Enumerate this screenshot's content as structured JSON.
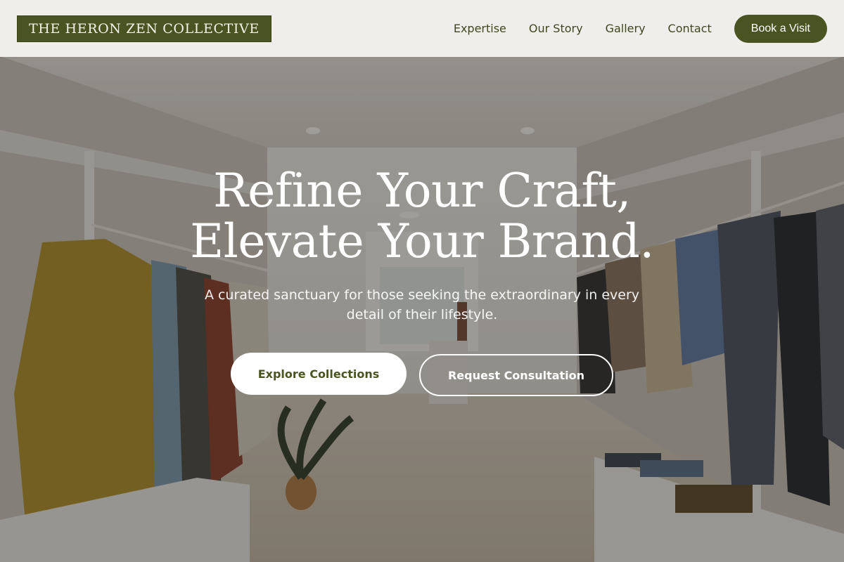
{
  "colors": {
    "brand": "#4a5422",
    "header_bg": "#f4f2ee",
    "text_light": "#ffffff"
  },
  "header": {
    "logo_text": "THE HERON ZEN COLLECTIVE",
    "nav": [
      {
        "label": "Expertise"
      },
      {
        "label": "Our Story"
      },
      {
        "label": "Gallery"
      },
      {
        "label": "Contact"
      }
    ],
    "cta_label": "Book a Visit"
  },
  "hero": {
    "headline_line1": "Refine Your Craft,",
    "headline_line2": "Elevate Your Brand.",
    "subtitle": "A curated sanctuary for those seeking the extraordinary in every detail of their lifestyle.",
    "primary_button": "Explore Collections",
    "secondary_button": "Request Consultation",
    "background_image": "boutique clothing store interior with garment racks"
  }
}
